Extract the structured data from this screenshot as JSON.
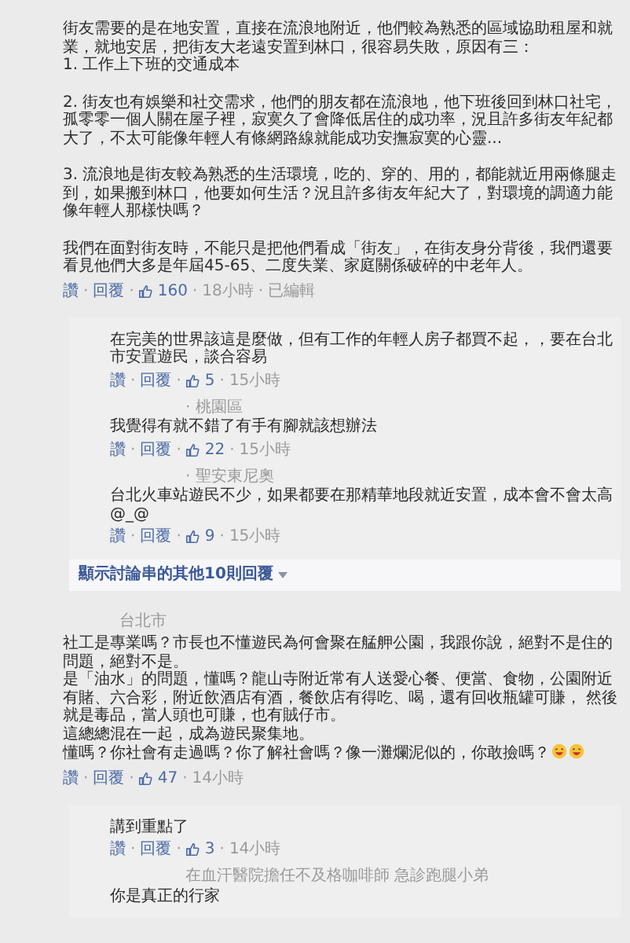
{
  "separator": "·",
  "comments": [
    {
      "blocks": [
        [
          "街友需要的是在地安置，直接在流浪地附近，他們較為熟悉的區域協助租屋和就業，就地安居，把街友大老遠安置到林口，很容易失敗，原因有三：",
          "1. 工作上下班的交通成本"
        ],
        [
          "2. 街友也有娛樂和社交需求，他們的朋友都在流浪地，他下班後回到林口社宅，孤零零一個人關在屋子裡，寂寞久了會降低居住的成功率，況且許多街友年紀都大了，不太可能像年輕人有條網路線就能成功安撫寂寞的心靈..."
        ],
        [
          "3. 流浪地是街友較為熟悉的生活環境，吃的、穿的、用的，都能就近用兩條腿走到，如果搬到林口，他要如何生活？況且許多街友年紀大了，對環境的調適力能像年輕人那樣快嗎？"
        ],
        [
          "我們在面對街友時，不能只是把他們看成「街友」，在街友身分背後，我們還要看見他們大多是年屆45-65、二度失業、家庭關係破碎的中老年人。"
        ]
      ],
      "actions": {
        "like": "讚",
        "reply": "回覆",
        "likes": "160",
        "time": "18小時",
        "edited": "已編輯"
      },
      "replies": [
        {
          "paragraphs": [
            "在完美的世界該這是麼做，但有工作的年輕人房子都買不起，，要在台北市安置遊民，談合容易"
          ],
          "actions": {
            "like": "讚",
            "reply": "回覆",
            "likes": "5",
            "time": "15小時"
          }
        },
        {
          "author": "· 桃園區",
          "paragraphs": [
            "我覺得有就不錯了有手有腳就該想辦法"
          ],
          "actions": {
            "like": "讚",
            "reply": "回覆",
            "likes": "22",
            "time": "15小時"
          }
        },
        {
          "author": "· 聖安東尼奧",
          "paragraphs": [
            "台北火車站遊民不少，如果都要在那精華地段就近安置，成本會不會太高 @_@"
          ],
          "actions": {
            "like": "讚",
            "reply": "回覆",
            "likes": "9",
            "time": "15小時"
          }
        }
      ],
      "more_replies": "顯示討論串的其他10則回覆"
    },
    {
      "author": "台北市",
      "blocks": [
        [
          "社工是專業嗎？市長也不懂遊民為何會聚在艋舺公園，我跟你說，絕對不是住的問題，絕對不是。",
          "是「油水」的問題，懂嗎？龍山寺附近常有人送愛心餐、便當、食物，公園附近有賭、六合彩，附近飲酒店有酒，餐飲店有得吃、喝，還有回收瓶罐可賺， 然後就是毒品，當人頭也可賺，也有賊仔市。",
          "這總總混在一起，成為遊民聚集地。",
          "懂嗎？你社會有走過嗎？你了解社會嗎？像一灘爛泥似的，你敢撿嗎？"
        ]
      ],
      "ends_with_emoji": true,
      "actions": {
        "like": "讚",
        "reply": "回覆",
        "likes": "47",
        "time": "14小時"
      },
      "replies": [
        {
          "paragraphs": [
            "講到重點了"
          ],
          "actions": {
            "like": "讚",
            "reply": "回覆",
            "likes": "3",
            "time": "14小時"
          }
        },
        {
          "author": "在血汗醫院擔任不及格咖啡師 急診跑腿小弟",
          "paragraphs": [
            "你是真正的行家"
          ]
        }
      ]
    }
  ]
}
